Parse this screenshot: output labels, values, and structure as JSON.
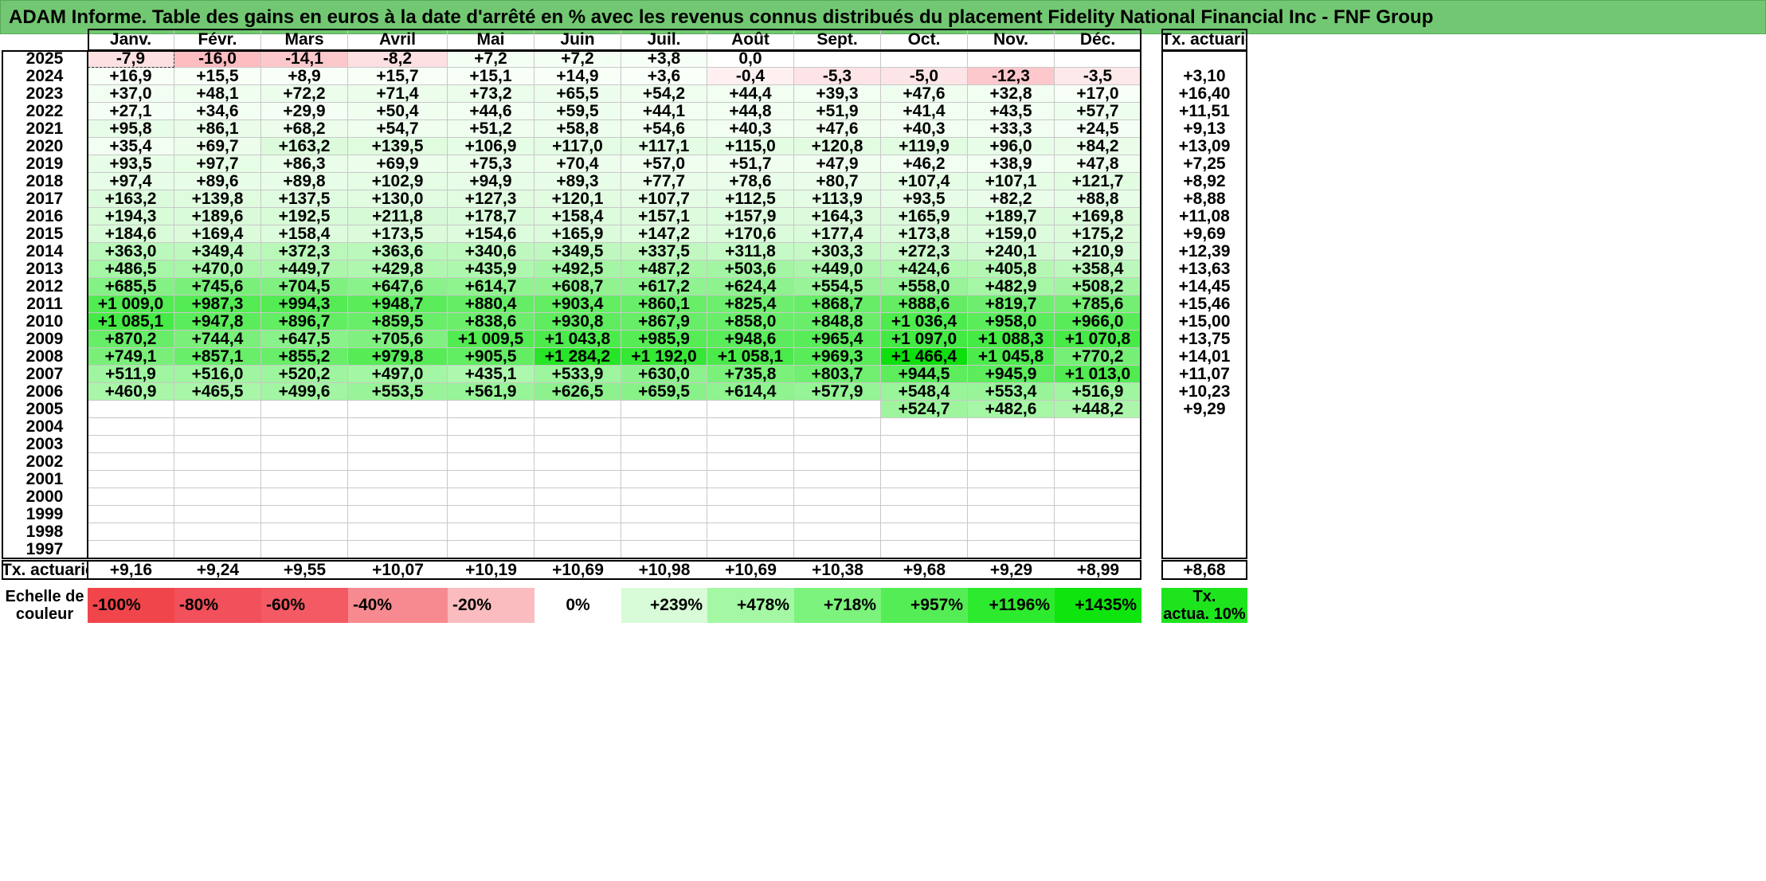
{
  "title": "ADAM Informe. Table des gains en euros à la date d'arrêté en % avec les revenus connus distribués du placement Fidelity National Financial Inc - FNF Group",
  "months": [
    "Janv.",
    "Févr.",
    "Mars",
    "Avril",
    "Mai",
    "Juin",
    "Juil.",
    "Août",
    "Sept.",
    "Oct.",
    "Nov.",
    "Déc."
  ],
  "rate_header": "Tx. actuariel",
  "footer_label": "Tx. actuariel",
  "rows": [
    {
      "year": "2025",
      "values": [
        "-7,9",
        "-16,0",
        "-14,1",
        "-8,2",
        "+7,2",
        "+7,2",
        "+3,8",
        "0,0",
        "",
        "",
        "",
        ""
      ],
      "rate": ""
    },
    {
      "year": "2024",
      "values": [
        "+16,9",
        "+15,5",
        "+8,9",
        "+15,7",
        "+15,1",
        "+14,9",
        "+3,6",
        "-0,4",
        "-5,3",
        "-5,0",
        "-12,3",
        "-3,5"
      ],
      "rate": "+3,10"
    },
    {
      "year": "2023",
      "values": [
        "+37,0",
        "+48,1",
        "+72,2",
        "+71,4",
        "+73,2",
        "+65,5",
        "+54,2",
        "+44,4",
        "+39,3",
        "+47,6",
        "+32,8",
        "+17,0"
      ],
      "rate": "+16,40"
    },
    {
      "year": "2022",
      "values": [
        "+27,1",
        "+34,6",
        "+29,9",
        "+50,4",
        "+44,6",
        "+59,5",
        "+44,1",
        "+44,8",
        "+51,9",
        "+41,4",
        "+43,5",
        "+57,7"
      ],
      "rate": "+11,51"
    },
    {
      "year": "2021",
      "values": [
        "+95,8",
        "+86,1",
        "+68,2",
        "+54,7",
        "+51,2",
        "+58,8",
        "+54,6",
        "+40,3",
        "+47,6",
        "+40,3",
        "+33,3",
        "+24,5"
      ],
      "rate": "+9,13"
    },
    {
      "year": "2020",
      "values": [
        "+35,4",
        "+69,7",
        "+163,2",
        "+139,5",
        "+106,9",
        "+117,0",
        "+117,1",
        "+115,0",
        "+120,8",
        "+119,9",
        "+96,0",
        "+84,2"
      ],
      "rate": "+13,09"
    },
    {
      "year": "2019",
      "values": [
        "+93,5",
        "+97,7",
        "+86,3",
        "+69,9",
        "+75,3",
        "+70,4",
        "+57,0",
        "+51,7",
        "+47,9",
        "+46,2",
        "+38,9",
        "+47,8"
      ],
      "rate": "+7,25"
    },
    {
      "year": "2018",
      "values": [
        "+97,4",
        "+89,6",
        "+89,8",
        "+102,9",
        "+94,9",
        "+89,3",
        "+77,7",
        "+78,6",
        "+80,7",
        "+107,4",
        "+107,1",
        "+121,7"
      ],
      "rate": "+8,92"
    },
    {
      "year": "2017",
      "values": [
        "+163,2",
        "+139,8",
        "+137,5",
        "+130,0",
        "+127,3",
        "+120,1",
        "+107,7",
        "+112,5",
        "+113,9",
        "+93,5",
        "+82,2",
        "+88,8"
      ],
      "rate": "+8,88"
    },
    {
      "year": "2016",
      "values": [
        "+194,3",
        "+189,6",
        "+192,5",
        "+211,8",
        "+178,7",
        "+158,4",
        "+157,1",
        "+157,9",
        "+164,3",
        "+165,9",
        "+189,7",
        "+169,8"
      ],
      "rate": "+11,08"
    },
    {
      "year": "2015",
      "values": [
        "+184,6",
        "+169,4",
        "+158,4",
        "+173,5",
        "+154,6",
        "+165,9",
        "+147,2",
        "+170,6",
        "+177,4",
        "+173,8",
        "+159,0",
        "+175,2"
      ],
      "rate": "+9,69"
    },
    {
      "year": "2014",
      "values": [
        "+363,0",
        "+349,4",
        "+372,3",
        "+363,6",
        "+340,6",
        "+349,5",
        "+337,5",
        "+311,8",
        "+303,3",
        "+272,3",
        "+240,1",
        "+210,9"
      ],
      "rate": "+12,39"
    },
    {
      "year": "2013",
      "values": [
        "+486,5",
        "+470,0",
        "+449,7",
        "+429,8",
        "+435,9",
        "+492,5",
        "+487,2",
        "+503,6",
        "+449,0",
        "+424,6",
        "+405,8",
        "+358,4"
      ],
      "rate": "+13,63"
    },
    {
      "year": "2012",
      "values": [
        "+685,5",
        "+745,6",
        "+704,5",
        "+647,6",
        "+614,7",
        "+608,7",
        "+617,2",
        "+624,4",
        "+554,5",
        "+558,0",
        "+482,9",
        "+508,2"
      ],
      "rate": "+14,45"
    },
    {
      "year": "2011",
      "values": [
        "+1 009,0",
        "+987,3",
        "+994,3",
        "+948,7",
        "+880,4",
        "+903,4",
        "+860,1",
        "+825,4",
        "+868,7",
        "+888,6",
        "+819,7",
        "+785,6"
      ],
      "rate": "+15,46"
    },
    {
      "year": "2010",
      "values": [
        "+1 085,1",
        "+947,8",
        "+896,7",
        "+859,5",
        "+838,6",
        "+930,8",
        "+867,9",
        "+858,0",
        "+848,8",
        "+1 036,4",
        "+958,0",
        "+966,0"
      ],
      "rate": "+15,00"
    },
    {
      "year": "2009",
      "values": [
        "+870,2",
        "+744,4",
        "+647,5",
        "+705,6",
        "+1 009,5",
        "+1 043,8",
        "+985,9",
        "+948,6",
        "+965,4",
        "+1 097,0",
        "+1 088,3",
        "+1 070,8"
      ],
      "rate": "+13,75"
    },
    {
      "year": "2008",
      "values": [
        "+749,1",
        "+857,1",
        "+855,2",
        "+979,8",
        "+905,5",
        "+1 284,2",
        "+1 192,0",
        "+1 058,1",
        "+969,3",
        "+1 466,4",
        "+1 045,8",
        "+770,2"
      ],
      "rate": "+14,01"
    },
    {
      "year": "2007",
      "values": [
        "+511,9",
        "+516,0",
        "+520,2",
        "+497,0",
        "+435,1",
        "+533,9",
        "+630,0",
        "+735,8",
        "+803,7",
        "+944,5",
        "+945,9",
        "+1 013,0"
      ],
      "rate": "+11,07"
    },
    {
      "year": "2006",
      "values": [
        "+460,9",
        "+465,5",
        "+499,6",
        "+553,5",
        "+561,9",
        "+626,5",
        "+659,5",
        "+614,4",
        "+577,9",
        "+548,4",
        "+553,4",
        "+516,9"
      ],
      "rate": "+10,23"
    },
    {
      "year": "2005",
      "values": [
        "",
        "",
        "",
        "",
        "",
        "",
        "",
        "",
        "",
        "+524,7",
        "+482,6",
        "+448,2"
      ],
      "rate": "+9,29"
    },
    {
      "year": "2004",
      "values": [
        "",
        "",
        "",
        "",
        "",
        "",
        "",
        "",
        "",
        "",
        "",
        ""
      ],
      "rate": ""
    },
    {
      "year": "2003",
      "values": [
        "",
        "",
        "",
        "",
        "",
        "",
        "",
        "",
        "",
        "",
        "",
        ""
      ],
      "rate": ""
    },
    {
      "year": "2002",
      "values": [
        "",
        "",
        "",
        "",
        "",
        "",
        "",
        "",
        "",
        "",
        "",
        ""
      ],
      "rate": ""
    },
    {
      "year": "2001",
      "values": [
        "",
        "",
        "",
        "",
        "",
        "",
        "",
        "",
        "",
        "",
        "",
        ""
      ],
      "rate": ""
    },
    {
      "year": "2000",
      "values": [
        "",
        "",
        "",
        "",
        "",
        "",
        "",
        "",
        "",
        "",
        "",
        ""
      ],
      "rate": ""
    },
    {
      "year": "1999",
      "values": [
        "",
        "",
        "",
        "",
        "",
        "",
        "",
        "",
        "",
        "",
        "",
        ""
      ],
      "rate": ""
    },
    {
      "year": "1998",
      "values": [
        "",
        "",
        "",
        "",
        "",
        "",
        "",
        "",
        "",
        "",
        "",
        ""
      ],
      "rate": ""
    },
    {
      "year": "1997",
      "values": [
        "",
        "",
        "",
        "",
        "",
        "",
        "",
        "",
        "",
        "",
        "",
        ""
      ],
      "rate": ""
    }
  ],
  "footer_values": [
    "+9,16",
    "+9,24",
    "+9,55",
    "+10,07",
    "+10,19",
    "+10,69",
    "+10,98",
    "+10,69",
    "+10,38",
    "+9,68",
    "+9,29",
    "+8,99"
  ],
  "footer_rate": "+8,68",
  "scale": {
    "label_line1": "Echelle de",
    "label_line2": "couleur",
    "items": [
      {
        "label": "-100%",
        "color": "#f0464b"
      },
      {
        "label": "-80%",
        "color": "#f2505a"
      },
      {
        "label": "-60%",
        "color": "#f45a64"
      },
      {
        "label": "-40%",
        "color": "#f78a90"
      },
      {
        "label": "-20%",
        "color": "#fbbcc0"
      },
      {
        "label": "0%",
        "color": "#ffffff"
      },
      {
        "label": "+239%",
        "color": "#d7fcd7"
      },
      {
        "label": "+478%",
        "color": "#a4f8a4"
      },
      {
        "label": "+718%",
        "color": "#7cf37c"
      },
      {
        "label": "+957%",
        "color": "#55ed55"
      },
      {
        "label": "+1196%",
        "color": "#2eea2e"
      },
      {
        "label": "+1435%",
        "color": "#0fe40f"
      }
    ],
    "rate_label_line1": "Tx.",
    "rate_label_line2": "actua. 10%",
    "rate_color": "#1ee41e"
  },
  "colors": {
    "title_bg": "#72c872",
    "row_2025": [
      "#fde0e2",
      "#fcbcc0",
      "#fcc8cc",
      "#fde0e2",
      "#f4fff4",
      "#f4fff4",
      "#f6fff6",
      "#ffffff"
    ],
    "row_2024_neg": [
      "#fde4e6",
      "#fde4e6",
      "#fcc8cc",
      "#fde8ea"
    ]
  }
}
